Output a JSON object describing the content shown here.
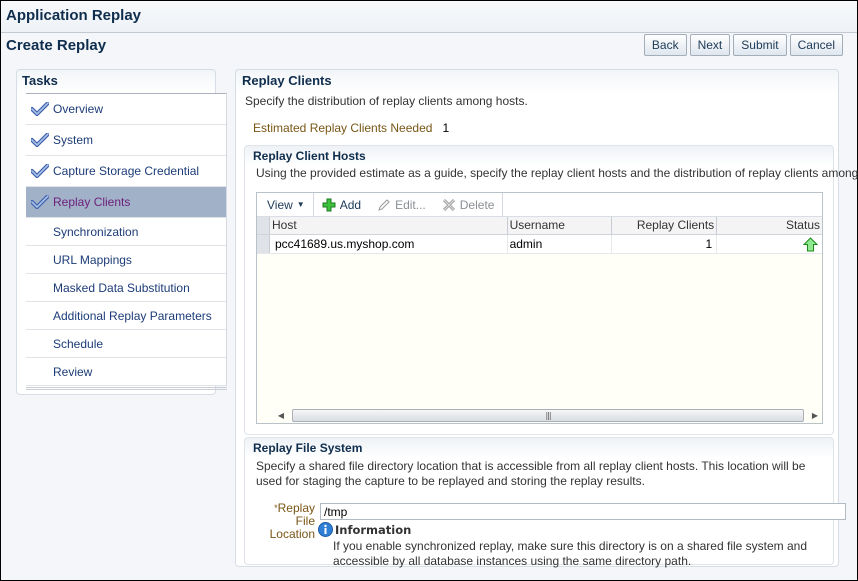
{
  "app": {
    "title": "Application Replay"
  },
  "page": {
    "title": "Create Replay"
  },
  "buttons": {
    "back": "Back",
    "next": "Next",
    "submit": "Submit",
    "cancel": "Cancel"
  },
  "tasks": {
    "title": "Tasks",
    "items": [
      {
        "label": "Overview",
        "completed": true,
        "selected": false
      },
      {
        "label": "System",
        "completed": true,
        "selected": false
      },
      {
        "label": "Capture Storage Credential",
        "completed": true,
        "selected": false
      },
      {
        "label": "Replay Clients",
        "completed": true,
        "selected": true
      },
      {
        "label": "Synchronization",
        "completed": false,
        "selected": false
      },
      {
        "label": "URL Mappings",
        "completed": false,
        "selected": false
      },
      {
        "label": "Masked Data Substitution",
        "completed": false,
        "selected": false
      },
      {
        "label": "Additional Replay Parameters",
        "completed": false,
        "selected": false
      },
      {
        "label": "Schedule",
        "completed": false,
        "selected": false
      },
      {
        "label": "Review",
        "completed": false,
        "selected": false
      }
    ]
  },
  "replay_clients": {
    "title": "Replay Clients",
    "description": "Specify the distribution of replay clients among hosts.",
    "estimated_label": "Estimated Replay Clients Needed",
    "estimated_value": "1",
    "hosts": {
      "title": "Replay Client Hosts",
      "description": "Using the provided estimate as a guide, specify the replay client hosts and the distribution of replay clients among them.",
      "toolbar": {
        "view": "View",
        "add": "Add",
        "edit": "Edit...",
        "delete": "Delete"
      },
      "columns": [
        "Host",
        "Username",
        "Replay Clients",
        "Status"
      ],
      "rows": [
        {
          "host": "pcc41689.us.myshop.com",
          "username": "admin",
          "replay_clients": "1",
          "status": "up"
        }
      ]
    }
  },
  "file_system": {
    "title": "Replay File System",
    "description": "Specify a shared file directory location that is accessible from all replay client hosts. This location will be used for staging the capture to be replayed and storing the replay results.",
    "field_label_line1": "Replay",
    "field_label_line2": "File",
    "field_label_line3": "Location",
    "required_marker": "*",
    "field_value": "/tmp",
    "info_title": "Information",
    "info_text": "If you enable synchronized replay, make sure this directory is on a shared file system and accessible by all database instances using the same directory path."
  },
  "colors": {
    "accent_title": "#0f2d4d",
    "selected_task_bg": "#a1b1c8",
    "label_gold": "#7a5616",
    "status_up": "#3fbf3f"
  }
}
